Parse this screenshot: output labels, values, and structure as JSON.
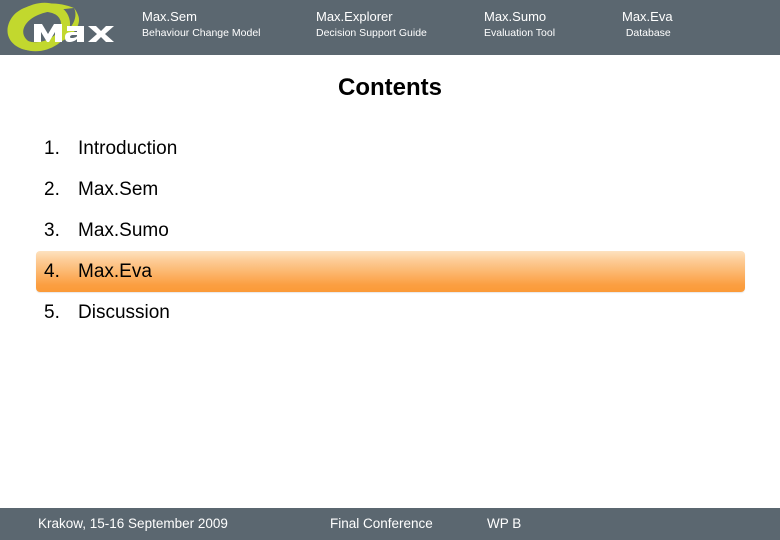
{
  "header": {
    "background_color": "#5b6770",
    "logo": {
      "name": "max-logo",
      "wordmark": "max",
      "swoosh_color": "#c2d82e",
      "text_color": "#ffffff"
    },
    "products": [
      {
        "title": "Max.Sem",
        "subtitle": "Behaviour Change Model"
      },
      {
        "title": "Max.Explorer",
        "subtitle": "Decision Support Guide"
      },
      {
        "title": "Max.Sumo",
        "subtitle": "Evaluation Tool"
      },
      {
        "title": "Max.Eva",
        "subtitle": "Database"
      }
    ]
  },
  "main": {
    "title": "Contents",
    "items": [
      {
        "number": "1.",
        "label": "Introduction",
        "highlighted": false
      },
      {
        "number": "2.",
        "label": "Max.Sem",
        "highlighted": false
      },
      {
        "number": "3.",
        "label": "Max.Sumo",
        "highlighted": false
      },
      {
        "number": "4.",
        "label": "Max.Eva",
        "highlighted": true
      },
      {
        "number": "5.",
        "label": "Discussion",
        "highlighted": false
      }
    ],
    "highlight_colors": {
      "gradient_top": "#fde2c0",
      "gradient_bottom": "#fb9a37"
    }
  },
  "footer": {
    "background_color": "#5b6770",
    "location_date": "Krakow, 15-16 September 2009",
    "event": "Final Conference",
    "workpackage": "WP B"
  }
}
